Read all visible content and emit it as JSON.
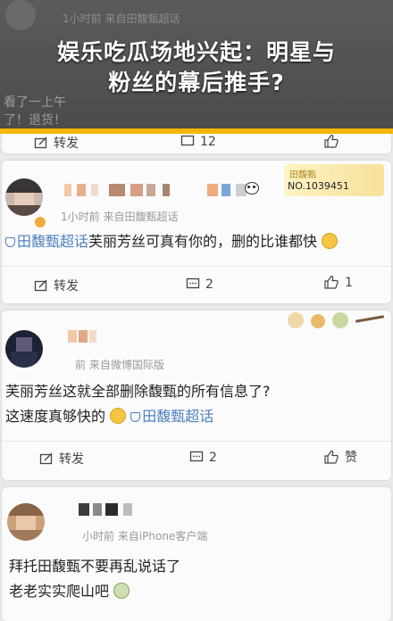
{
  "banner": {
    "title_line1": "娱乐吃瓜场地兴起：明星与",
    "title_line2": "粉丝的幕后推手?"
  },
  "top_partial": {
    "meta": "1小时前  来自田馥甄超话",
    "text_left": "看了一上午",
    "text_line2": "了！退货！",
    "repost_label": "转发",
    "comment_count": "12"
  },
  "comments": [
    {
      "meta": "1小时前  来自田馥甄超话",
      "badge": {
        "label": "田馥甄",
        "number": "NO.1039451"
      },
      "topic": "田馥甄超话",
      "text": "芙丽芳丝可真有你的，删的比谁都快",
      "repost_label": "转发",
      "comment_count": "2",
      "like_count": "1"
    },
    {
      "meta": "前  来自微博国际版",
      "line1": "芙丽芳丝这就全部删除馥甄的所有信息了?",
      "line2": "这速度真够快的",
      "topic": "田馥甄超话",
      "repost_label": "转发",
      "comment_count": "2",
      "like_label": "赞"
    },
    {
      "meta": "小时前  来自iPhone客户端",
      "line1": "拜托田馥甄不要再乱说话了",
      "line2": "老老实实爬山吧"
    }
  ],
  "colors": {
    "banner_bg": "#4a4a4a",
    "stripe": "#f2b800",
    "topic": "#4c7fc0"
  },
  "icons": [
    "repost-icon",
    "comment-icon",
    "like-icon",
    "topic-shield-icon",
    "smile-emoji-icon"
  ]
}
